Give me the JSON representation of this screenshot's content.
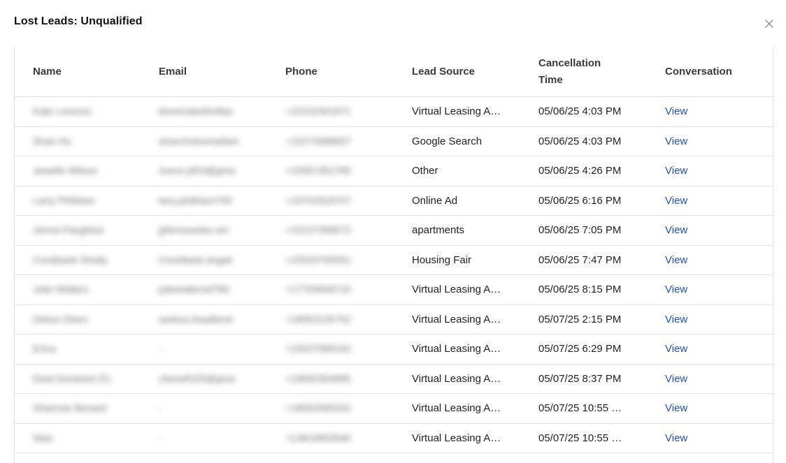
{
  "modal": {
    "title": "Lost Leads: Unqualified"
  },
  "table": {
    "headers": {
      "name": "Name",
      "email": "Email",
      "phone": "Phone",
      "lead_source": "Lead Source",
      "cancellation_time": "Cancellation Time",
      "conversation": "Conversation"
    },
    "rows": [
      {
        "name": "Kate Lorenzo",
        "email": "kloremakethelfas",
        "phone": "+15102301871",
        "lead_source": "Virtual Leasing A…",
        "cancellation_time": "05/06/25 4:03 PM",
        "conversation": "View"
      },
      {
        "name": "Shan Ho",
        "email": "shanchohomaifam",
        "phone": "+15272698907",
        "lead_source": "Google Search",
        "cancellation_time": "05/06/25 4:03 PM",
        "conversation": "View"
      },
      {
        "name": "Jewelle Wilson",
        "email": "Avera pf23@gma",
        "phone": "+19357352785",
        "lead_source": "Other",
        "cancellation_time": "05/06/25 4:26 PM",
        "conversation": "View"
      },
      {
        "name": "Larry Phillston",
        "email": "larry.phillston793",
        "phone": "+15752925707",
        "lead_source": "Online Ad",
        "cancellation_time": "05/06/25 6:16 PM",
        "conversation": "View"
      },
      {
        "name": "Jenna Paughton",
        "email": "jpfenooedoo.sm",
        "phone": "+15137358572",
        "lead_source": "apartments",
        "cancellation_time": "05/06/25 7:05 PM",
        "conversation": "View"
      },
      {
        "name": "Crestbank Shetly",
        "email": "Crestbank.angek",
        "phone": "+15525705551",
        "lead_source": "Housing Fair",
        "cancellation_time": "05/06/25 7:47 PM",
        "conversation": "View"
      },
      {
        "name": "Julie Walters",
        "email": "juliewaltersd789",
        "phone": "+17755608715",
        "lead_source": "Virtual Leasing A…",
        "cancellation_time": "05/06/25 8:15 PM",
        "conversation": "View"
      },
      {
        "name": "Debra Olsen",
        "email": "sedora.treadlend",
        "phone": "+18053135752",
        "lead_source": "Virtual Leasing A…",
        "cancellation_time": "05/07/25 2:15 PM",
        "conversation": "View"
      },
      {
        "name": "Erica",
        "email": "-",
        "phone": "+15037068162",
        "lead_source": "Virtual Leasing A…",
        "cancellation_time": "05/07/25 6:29 PM",
        "conversation": "View"
      },
      {
        "name": "Deal Dominion Ev",
        "email": "chenell105@gma",
        "phone": "+18645354985",
        "lead_source": "Virtual Leasing A…",
        "cancellation_time": "05/07/25 8:37 PM",
        "conversation": "View"
      },
      {
        "name": "Shannan Benard",
        "email": "-",
        "phone": "+18052995332",
        "lead_source": "Virtual Leasing A…",
        "cancellation_time": "05/07/25 10:55 …",
        "conversation": "View"
      },
      {
        "name": "Stan",
        "email": "-",
        "phone": "+13819953540",
        "lead_source": "Virtual Leasing A…",
        "cancellation_time": "05/07/25 10:55 …",
        "conversation": "View"
      }
    ]
  },
  "colors": {
    "link": "#1f4fc8",
    "border": "#e2e2e2",
    "title": "#111111"
  },
  "icons": {
    "close": "close-icon"
  }
}
